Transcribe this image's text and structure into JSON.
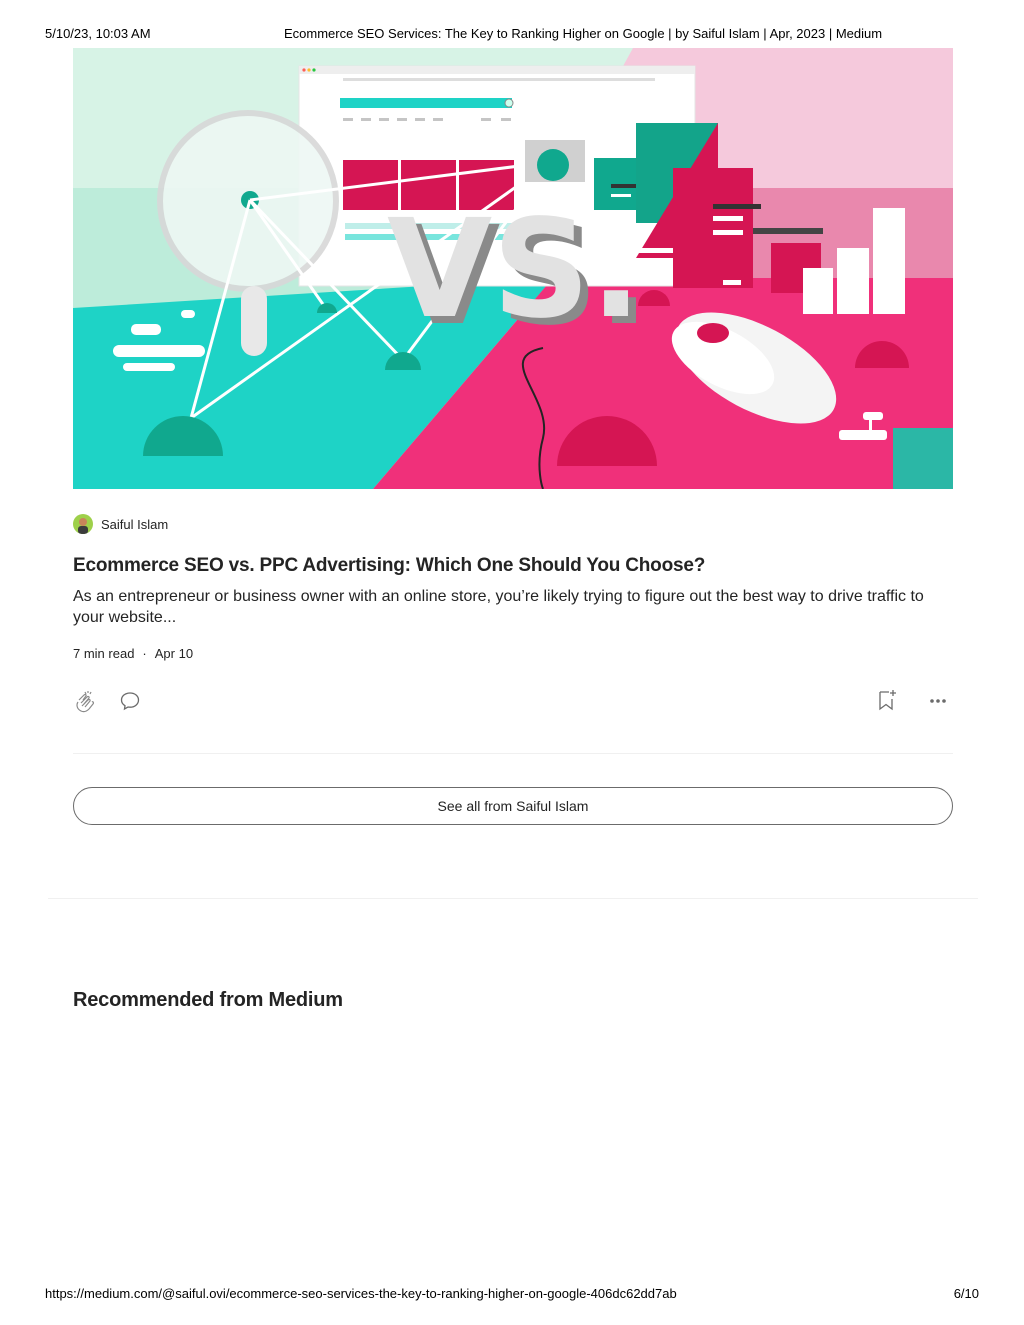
{
  "print_header": {
    "date": "5/10/23, 10:03 AM",
    "title": "Ecommerce SEO Services: The Key to Ranking Higher on Google | by Saiful Islam | Apr, 2023 | Medium"
  },
  "hero": {
    "illustration_text": "VS."
  },
  "post": {
    "author": "Saiful Islam",
    "title": "Ecommerce SEO vs. PPC Advertising: Which One Should You Choose?",
    "excerpt": "As an entrepreneur or business owner with an online store, you’re likely trying to figure out the best way to drive traffic to your website...",
    "read_time": "7 min read",
    "separator": "·",
    "date": "Apr 10"
  },
  "actions": {
    "icons": [
      "clap-icon",
      "comment-icon",
      "bookmark-add-icon",
      "more-icon"
    ]
  },
  "see_all_label": "See all from Saiful Islam",
  "recommended_heading": "Recommended from Medium",
  "print_footer": {
    "url": "https://medium.com/@saiful.ovi/ecommerce-seo-services-the-key-to-ranking-higher-on-google-406dc62dd7ab",
    "page": "6/10"
  },
  "colors": {
    "teal": "#1ed3c6",
    "pink": "#f0307a",
    "crimson": "#d51553",
    "mint": "#d7f3e6",
    "light_pink": "#f5c9dc",
    "text": "#242424"
  }
}
